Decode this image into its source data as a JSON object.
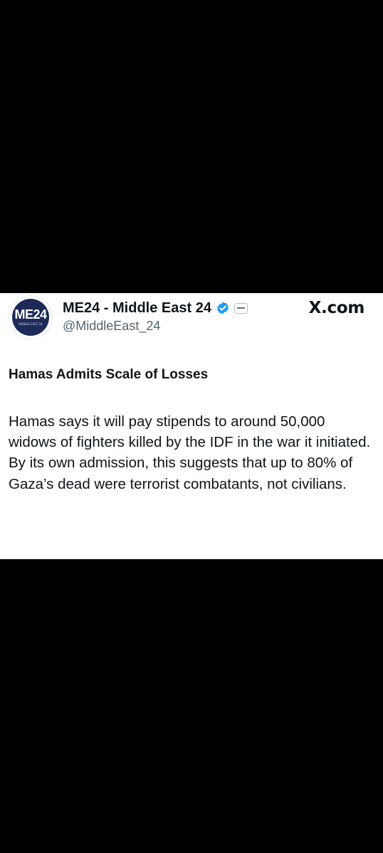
{
  "account": {
    "display_name": "ME24 - Middle East 24",
    "handle": "@MiddleEast_24",
    "logo_text": "ME24",
    "logo_subtext": "MIDDLE EAST 24"
  },
  "site_label": "X.com",
  "post": {
    "headline": "Hamas Admits Scale of Losses",
    "paragraph_1": "Hamas says it will pay stipends to around 50,000 widows of fighters killed by the IDF in the war it initiated.",
    "paragraph_2": "By its own admission, this suggests that up to 80% of Gaza’s dead were terrorist combatants, not civilians."
  },
  "icons": {
    "verified": "verified-check-icon",
    "affiliate": "affiliate-badge-icon"
  },
  "colors": {
    "verified_blue": "#1d9bf0",
    "handle_gray": "#536471",
    "logo_navy": "#1d2a57"
  }
}
